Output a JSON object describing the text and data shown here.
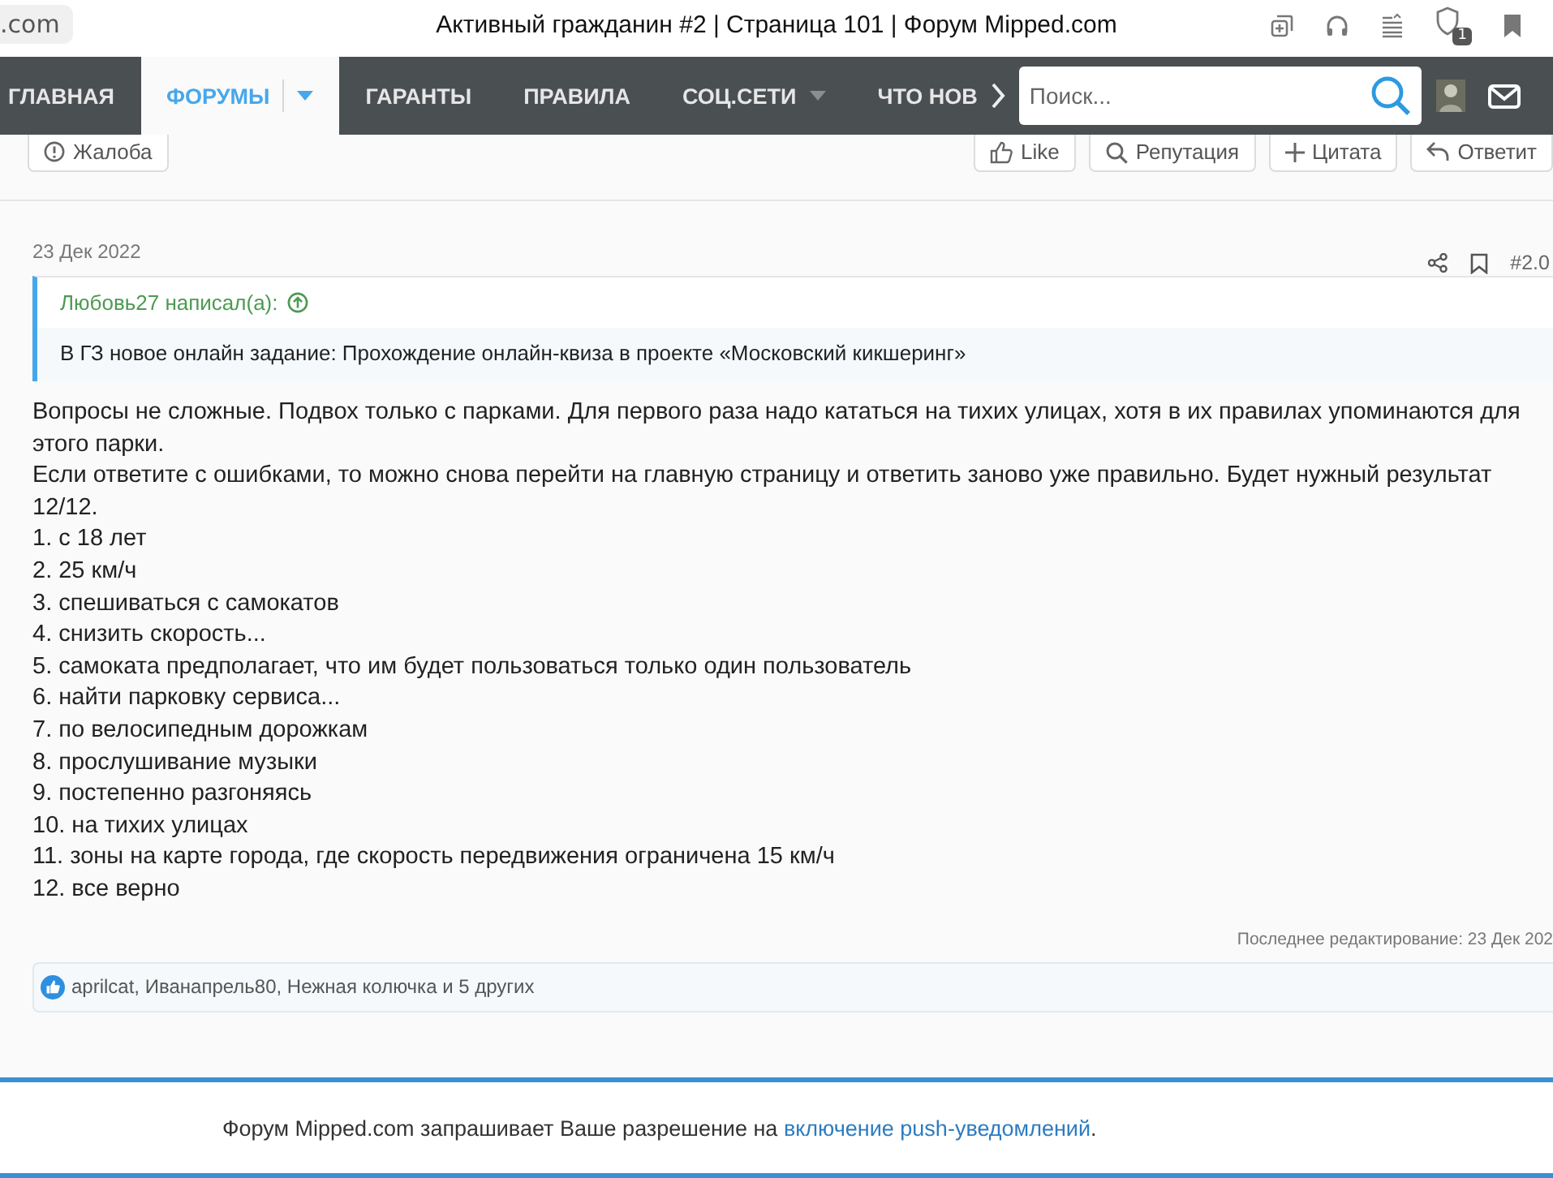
{
  "browser": {
    "address": ".com",
    "title": "Активный гражданин #2 | Страница 101 | Форум Mipped.com",
    "badge": "1"
  },
  "nav": {
    "items": [
      {
        "label": "ГЛАВНАЯ",
        "selected": false,
        "dropdown": false
      },
      {
        "label": "ФОРУМЫ",
        "selected": true,
        "dropdown": true
      },
      {
        "label": "ГАРАНТЫ",
        "selected": false,
        "dropdown": false
      },
      {
        "label": "ПРАВИЛА",
        "selected": false,
        "dropdown": false
      },
      {
        "label": "СОЦ.СЕТИ",
        "selected": false,
        "dropdown": true
      },
      {
        "label": "ЧТО НОВ",
        "selected": false,
        "dropdown": false
      }
    ],
    "search_placeholder": "Поиск..."
  },
  "top_actions": {
    "report": "Жалоба",
    "buttons": [
      {
        "kind": "like",
        "label": "Like"
      },
      {
        "kind": "reputation",
        "label": "Репутация"
      },
      {
        "kind": "quote",
        "label": "Цитата"
      },
      {
        "kind": "reply",
        "label": "Ответит"
      }
    ]
  },
  "post": {
    "date": "23 Дек 2022",
    "number": "#2.0",
    "quote": {
      "author": "Любовь27 написал(а):",
      "text": "В ГЗ новое онлайн задание: Прохождение онлайн-квиза в проекте «Московский кикшеринг»"
    },
    "lines": [
      "Вопросы не сложные. Подвох только с парками. Для первого раза надо кататься на тихих улицах, хотя в их правилах упоминаются для этого парки.",
      "Если ответите с ошибками, то можно снова перейти на главную страницу и ответить заново уже правильно. Будет нужный результат 12/12.",
      "1. с 18 лет",
      "2. 25 км/ч",
      "3. спешиваться с самокатов",
      "4. снизить скорость...",
      "5. самоката предполагает, что им будет пользоваться только один пользователь",
      "6. найти парковку сервиса...",
      "7. по велосипедным дорожкам",
      "8. прослушивание музыки",
      "9. постепенно разгоняясь",
      "10. на тихих улицах",
      "11. зоны на карте города, где скорость передвижения ограничена 15 км/ч",
      "12. все верно"
    ],
    "edited": "Последнее редактирование: 23 Дек 202",
    "likes": "aprilcat, Иванапрель80, Нежная колючка и 5 других"
  },
  "notice": {
    "text": "Форум Mipped.com запрашивает Ваше разрешение на ",
    "link": "включение push-уведомлений",
    "end": "."
  }
}
